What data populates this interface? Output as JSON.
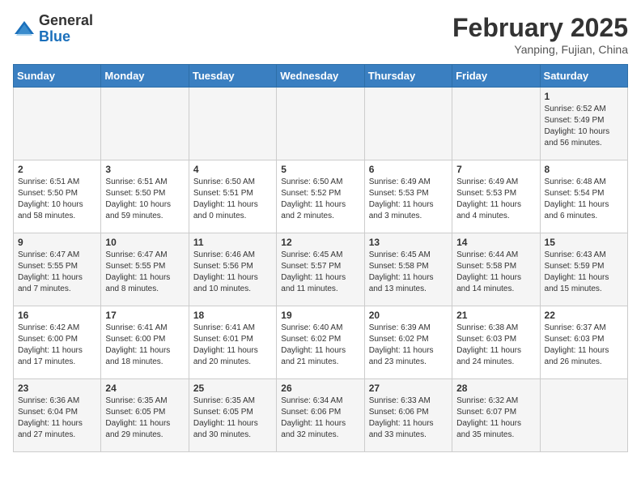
{
  "header": {
    "logo_general": "General",
    "logo_blue": "Blue",
    "month_year": "February 2025",
    "location": "Yanping, Fujian, China"
  },
  "days_of_week": [
    "Sunday",
    "Monday",
    "Tuesday",
    "Wednesday",
    "Thursday",
    "Friday",
    "Saturday"
  ],
  "weeks": [
    [
      {
        "day": "",
        "info": ""
      },
      {
        "day": "",
        "info": ""
      },
      {
        "day": "",
        "info": ""
      },
      {
        "day": "",
        "info": ""
      },
      {
        "day": "",
        "info": ""
      },
      {
        "day": "",
        "info": ""
      },
      {
        "day": "1",
        "info": "Sunrise: 6:52 AM\nSunset: 5:49 PM\nDaylight: 10 hours and 56 minutes."
      }
    ],
    [
      {
        "day": "2",
        "info": "Sunrise: 6:51 AM\nSunset: 5:50 PM\nDaylight: 10 hours and 58 minutes."
      },
      {
        "day": "3",
        "info": "Sunrise: 6:51 AM\nSunset: 5:50 PM\nDaylight: 10 hours and 59 minutes."
      },
      {
        "day": "4",
        "info": "Sunrise: 6:50 AM\nSunset: 5:51 PM\nDaylight: 11 hours and 0 minutes."
      },
      {
        "day": "5",
        "info": "Sunrise: 6:50 AM\nSunset: 5:52 PM\nDaylight: 11 hours and 2 minutes."
      },
      {
        "day": "6",
        "info": "Sunrise: 6:49 AM\nSunset: 5:53 PM\nDaylight: 11 hours and 3 minutes."
      },
      {
        "day": "7",
        "info": "Sunrise: 6:49 AM\nSunset: 5:53 PM\nDaylight: 11 hours and 4 minutes."
      },
      {
        "day": "8",
        "info": "Sunrise: 6:48 AM\nSunset: 5:54 PM\nDaylight: 11 hours and 6 minutes."
      }
    ],
    [
      {
        "day": "9",
        "info": "Sunrise: 6:47 AM\nSunset: 5:55 PM\nDaylight: 11 hours and 7 minutes."
      },
      {
        "day": "10",
        "info": "Sunrise: 6:47 AM\nSunset: 5:55 PM\nDaylight: 11 hours and 8 minutes."
      },
      {
        "day": "11",
        "info": "Sunrise: 6:46 AM\nSunset: 5:56 PM\nDaylight: 11 hours and 10 minutes."
      },
      {
        "day": "12",
        "info": "Sunrise: 6:45 AM\nSunset: 5:57 PM\nDaylight: 11 hours and 11 minutes."
      },
      {
        "day": "13",
        "info": "Sunrise: 6:45 AM\nSunset: 5:58 PM\nDaylight: 11 hours and 13 minutes."
      },
      {
        "day": "14",
        "info": "Sunrise: 6:44 AM\nSunset: 5:58 PM\nDaylight: 11 hours and 14 minutes."
      },
      {
        "day": "15",
        "info": "Sunrise: 6:43 AM\nSunset: 5:59 PM\nDaylight: 11 hours and 15 minutes."
      }
    ],
    [
      {
        "day": "16",
        "info": "Sunrise: 6:42 AM\nSunset: 6:00 PM\nDaylight: 11 hours and 17 minutes."
      },
      {
        "day": "17",
        "info": "Sunrise: 6:41 AM\nSunset: 6:00 PM\nDaylight: 11 hours and 18 minutes."
      },
      {
        "day": "18",
        "info": "Sunrise: 6:41 AM\nSunset: 6:01 PM\nDaylight: 11 hours and 20 minutes."
      },
      {
        "day": "19",
        "info": "Sunrise: 6:40 AM\nSunset: 6:02 PM\nDaylight: 11 hours and 21 minutes."
      },
      {
        "day": "20",
        "info": "Sunrise: 6:39 AM\nSunset: 6:02 PM\nDaylight: 11 hours and 23 minutes."
      },
      {
        "day": "21",
        "info": "Sunrise: 6:38 AM\nSunset: 6:03 PM\nDaylight: 11 hours and 24 minutes."
      },
      {
        "day": "22",
        "info": "Sunrise: 6:37 AM\nSunset: 6:03 PM\nDaylight: 11 hours and 26 minutes."
      }
    ],
    [
      {
        "day": "23",
        "info": "Sunrise: 6:36 AM\nSunset: 6:04 PM\nDaylight: 11 hours and 27 minutes."
      },
      {
        "day": "24",
        "info": "Sunrise: 6:35 AM\nSunset: 6:05 PM\nDaylight: 11 hours and 29 minutes."
      },
      {
        "day": "25",
        "info": "Sunrise: 6:35 AM\nSunset: 6:05 PM\nDaylight: 11 hours and 30 minutes."
      },
      {
        "day": "26",
        "info": "Sunrise: 6:34 AM\nSunset: 6:06 PM\nDaylight: 11 hours and 32 minutes."
      },
      {
        "day": "27",
        "info": "Sunrise: 6:33 AM\nSunset: 6:06 PM\nDaylight: 11 hours and 33 minutes."
      },
      {
        "day": "28",
        "info": "Sunrise: 6:32 AM\nSunset: 6:07 PM\nDaylight: 11 hours and 35 minutes."
      },
      {
        "day": "",
        "info": ""
      }
    ]
  ]
}
